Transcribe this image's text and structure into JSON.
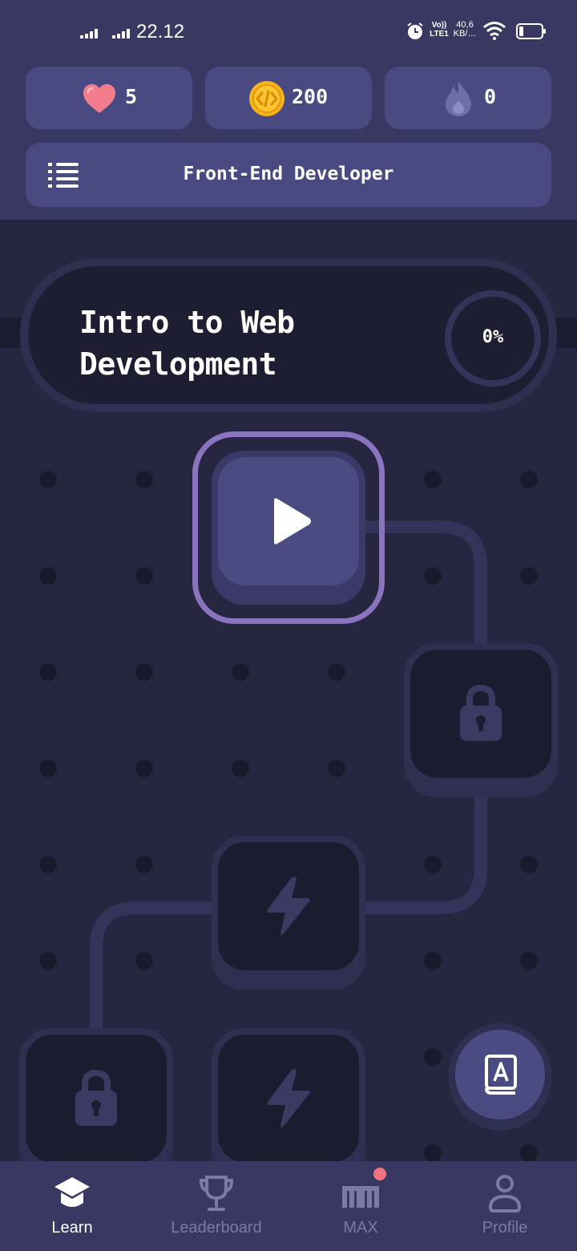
{
  "status_bar": {
    "time": "22.12",
    "network_label": "Vo)) LTE1",
    "speed_label": "40,6 KB/…"
  },
  "stats": {
    "hearts": "5",
    "coins": "200",
    "streak": "0"
  },
  "course": {
    "title": "Front-End Developer"
  },
  "section": {
    "title_line1": "Intro to Web",
    "title_line2": "Development",
    "progress": "0%"
  },
  "nodes": [
    {
      "type": "play",
      "state": "current"
    },
    {
      "type": "lock",
      "state": "locked"
    },
    {
      "type": "lightning",
      "state": "locked"
    },
    {
      "type": "lock",
      "state": "locked"
    },
    {
      "type": "lightning",
      "state": "locked"
    }
  ],
  "nav": {
    "items": [
      {
        "label": "Learn",
        "icon": "graduation-cap-icon",
        "active": true
      },
      {
        "label": "Leaderboard",
        "icon": "trophy-icon",
        "active": false
      },
      {
        "label": "MAX",
        "icon": "max-icon",
        "active": false,
        "badge": true
      },
      {
        "label": "Profile",
        "icon": "person-icon",
        "active": false
      }
    ]
  },
  "colors": {
    "header_bg": "#393862",
    "card_bg": "#4a4a82",
    "page_bg": "#262641",
    "node_dark": "#1c1c31",
    "accent_purple": "#8a74c0",
    "heart": "#f27d8c",
    "coin": "#f7b418",
    "badge": "#f0737d"
  }
}
